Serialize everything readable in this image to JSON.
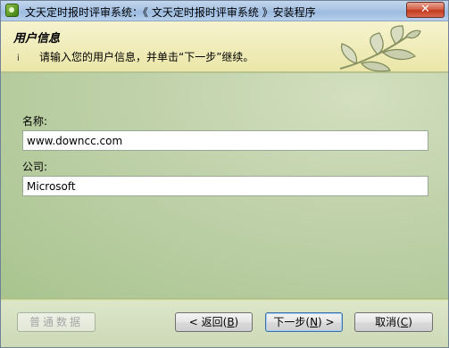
{
  "window": {
    "title": "文天定时报时评审系统：《 文天定时报时评审系统 》安装程序",
    "close_symbol": "✕"
  },
  "header": {
    "title": "用户信息",
    "info_marker": "i",
    "subtitle": "请输入您的用户信息，并单击“下一步”继续。"
  },
  "form": {
    "name_label": "名称:",
    "name_value": "www.downcc.com",
    "company_label": "公司:",
    "company_value": "Microsoft"
  },
  "footer": {
    "ordinary_data_label": "普通数据",
    "back_label": "< 返回(",
    "back_key": "B",
    "back_suffix": ")",
    "next_label": "下一步(",
    "next_key": "N",
    "next_suffix": ") >",
    "cancel_label": "取消(",
    "cancel_key": "C",
    "cancel_suffix": ")"
  },
  "icons": {
    "app": "installer-app-icon",
    "decoration": "leaf-branch-icon",
    "close": "close-icon"
  }
}
